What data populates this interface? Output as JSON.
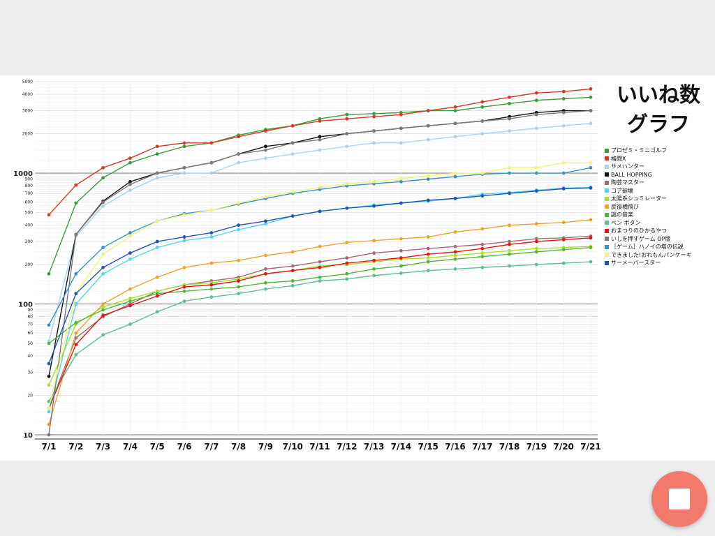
{
  "title": {
    "line1": "いいね数",
    "line2": "グラフ"
  },
  "colors": {
    "background": "#ffffff",
    "stop_button": "#f17a6a"
  },
  "stop_button": {
    "icon": "stop-icon"
  },
  "chart_data": {
    "type": "line",
    "y_scale": "log",
    "ylim": [
      10,
      5000
    ],
    "grid": true,
    "legend_position": "right",
    "y_ticks": [
      10,
      20,
      30,
      40,
      50,
      60,
      70,
      80,
      90,
      100,
      200,
      300,
      400,
      500,
      600,
      700,
      800,
      900,
      1000,
      2000,
      3000,
      4000,
      5000
    ],
    "categories": [
      "7/1",
      "7/2",
      "7/3",
      "7/4",
      "7/5",
      "7/6",
      "7/7",
      "7/8",
      "7/9",
      "7/10",
      "7/11",
      "7/12",
      "7/13",
      "7/14",
      "7/15",
      "7/16",
      "7/17",
      "7/18",
      "7/19",
      "7/20",
      "7/21"
    ],
    "series": [
      {
        "name": "プロゼミ・ミニゴルフ",
        "color": "#3a9c3a",
        "values": [
          170,
          590,
          920,
          1200,
          1400,
          1600,
          1700,
          1950,
          2150,
          2300,
          2600,
          2800,
          2850,
          2900,
          3000,
          3000,
          3200,
          3400,
          3600,
          3700,
          3800
        ]
      },
      {
        "name": "格闘X",
        "color": "#d63a26",
        "values": [
          480,
          810,
          1100,
          1300,
          1600,
          1700,
          1700,
          1900,
          2100,
          2300,
          2500,
          2600,
          2700,
          2800,
          3000,
          3200,
          3500,
          3800,
          4100,
          4200,
          4400
        ]
      },
      {
        "name": "サメハンター",
        "color": "#a7d3ee",
        "values": [
          52,
          330,
          560,
          740,
          920,
          1000,
          1000,
          1200,
          1300,
          1400,
          1500,
          1600,
          1700,
          1700,
          1800,
          1900,
          2000,
          2100,
          2200,
          2300,
          2400
        ]
      },
      {
        "name": "BALL HOPPING",
        "color": "#111111",
        "values": [
          28,
          340,
          610,
          860,
          1000,
          1100,
          1200,
          1400,
          1600,
          1700,
          1900,
          2000,
          2100,
          2200,
          2300,
          2400,
          2500,
          2700,
          2900,
          3000,
          3000
        ]
      },
      {
        "name": "陶芸マスター",
        "color": "#a66a73",
        "values": [
          16,
          55,
          80,
          100,
          125,
          140,
          150,
          160,
          185,
          195,
          210,
          225,
          245,
          255,
          265,
          275,
          285,
          300,
          315,
          320,
          330
        ]
      },
      {
        "name": "コア破壊",
        "color": "#4fd6f6",
        "values": [
          15,
          100,
          170,
          220,
          270,
          305,
          325,
          370,
          410,
          470,
          510,
          540,
          570,
          590,
          610,
          640,
          690,
          710,
          740,
          770,
          780
        ]
      },
      {
        "name": "太陽系シュミレーター",
        "color": "#a2e42a",
        "values": [
          24,
          70,
          95,
          110,
          125,
          140,
          145,
          155,
          170,
          180,
          195,
          200,
          210,
          220,
          225,
          235,
          245,
          255,
          265,
          270,
          275
        ]
      },
      {
        "name": "反復横飛び",
        "color": "#f0a22a",
        "values": [
          12,
          60,
          100,
          130,
          160,
          190,
          205,
          215,
          235,
          250,
          275,
          295,
          305,
          315,
          325,
          355,
          375,
          400,
          410,
          420,
          440
        ]
      },
      {
        "name": "謎の音楽",
        "color": "#54b53f",
        "values": [
          50,
          72,
          90,
          105,
          120,
          125,
          130,
          135,
          145,
          150,
          160,
          170,
          185,
          195,
          210,
          220,
          230,
          240,
          250,
          260,
          270
        ]
      },
      {
        "name": "ペン ボタン",
        "color": "#5cbf97",
        "values": [
          18,
          41,
          58,
          70,
          87,
          105,
          113,
          120,
          130,
          138,
          150,
          155,
          165,
          172,
          180,
          185,
          190,
          195,
          200,
          205,
          210
        ]
      },
      {
        "name": "おまつりのひかるやつ",
        "color": "#e01818",
        "values": [
          16,
          49,
          82,
          97,
          115,
          135,
          140,
          150,
          170,
          180,
          190,
          205,
          215,
          225,
          240,
          250,
          265,
          285,
          300,
          310,
          320
        ]
      },
      {
        "name": "いしを押すゲーム OP版",
        "color": "#7a7a7a",
        "values": [
          10,
          340,
          600,
          820,
          1000,
          1100,
          1200,
          1400,
          1500,
          1700,
          1800,
          2000,
          2100,
          2200,
          2300,
          2400,
          2500,
          2600,
          2800,
          2900,
          3000
        ]
      },
      {
        "name": "［ゲーム］ハノイの塔の伝説",
        "color": "#3a94c0",
        "values": [
          69,
          170,
          270,
          350,
          430,
          490,
          520,
          580,
          640,
          700,
          750,
          800,
          830,
          860,
          900,
          940,
          980,
          1000,
          1000,
          1000,
          1100
        ]
      },
      {
        "name": "できました!おれもんパンケーキ",
        "color": "#f3f37a",
        "values": [
          16,
          120,
          240,
          330,
          430,
          480,
          520,
          590,
          660,
          720,
          780,
          830,
          860,
          910,
          950,
          1000,
          1000,
          1100,
          1100,
          1200,
          1200
        ]
      },
      {
        "name": "サーメーバースター",
        "color": "#1f55b5",
        "values": [
          35,
          120,
          190,
          245,
          300,
          325,
          350,
          400,
          430,
          470,
          510,
          540,
          560,
          590,
          620,
          640,
          670,
          700,
          730,
          760,
          770
        ]
      }
    ]
  }
}
